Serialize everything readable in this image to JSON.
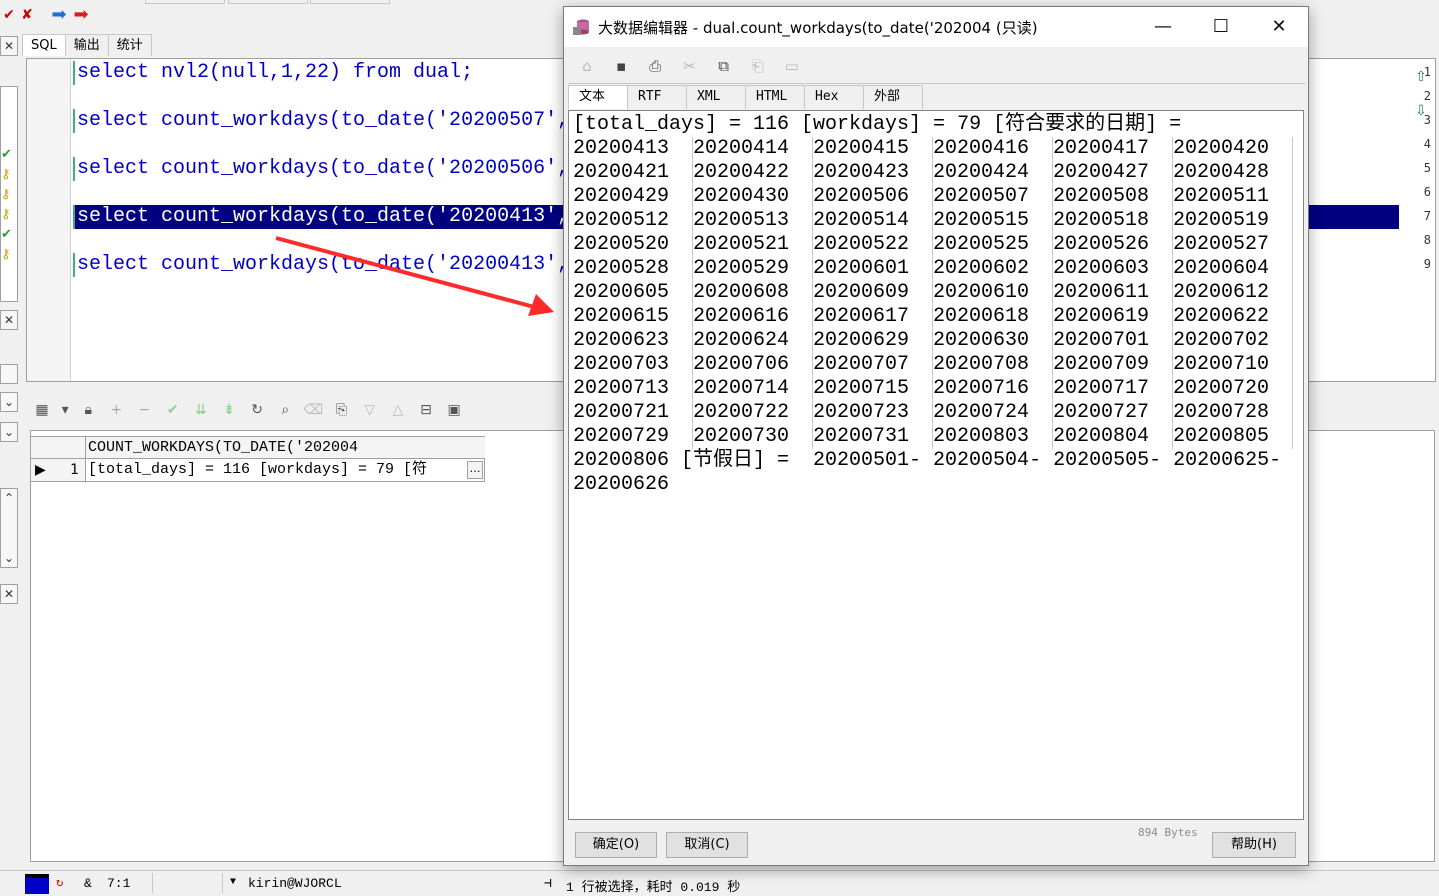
{
  "topbar": {
    "icons": [
      "run-icon",
      "stop-icon",
      "forward-icon",
      "back-icon"
    ]
  },
  "editor_tabs": [
    "SQL",
    "输出",
    "统计"
  ],
  "editor": {
    "lines": [
      {
        "num": "1",
        "text": "select nvl2(null,1,22) from dual;"
      },
      {
        "num": "2",
        "text": ""
      },
      {
        "num": "3",
        "text": "select count_workdays(to_date('20200507',"
      },
      {
        "num": "4",
        "text": ""
      },
      {
        "num": "5",
        "text": "select count_workdays(to_date('20200506',"
      },
      {
        "num": "6",
        "text": ""
      },
      {
        "num": "7",
        "text": "select count_workdays(to_date('20200413',"
      },
      {
        "num": "8",
        "text": ""
      },
      {
        "num": "9",
        "text": "select count_workdays(to_date('20200413',"
      }
    ],
    "selected_line": "7"
  },
  "grid": {
    "column_header": "COUNT_WORKDAYS(TO_DATE('202004",
    "row_number": "1",
    "cell_value": "[total_days] = 116 [workdays] = 79 [符",
    "cell_more": "…"
  },
  "status": {
    "mode": "&",
    "position": "7:1",
    "connection": "kirin@WJORCL",
    "message": "1 行被选择，耗时 0.019 秒"
  },
  "dialog": {
    "title": "大数据编辑器 - dual.count_workdays(to_date('202004 (只读)",
    "tabs": [
      "文本",
      "RTF",
      "XML",
      "HTML",
      "Hex",
      "外部"
    ],
    "first_line": "[total_days] = 116 [workdays] = 79 [符合要求的日期] =",
    "date_rows": [
      [
        "20200413",
        "20200414",
        "20200415",
        "20200416",
        "20200417",
        "20200420"
      ],
      [
        "20200421",
        "20200422",
        "20200423",
        "20200424",
        "20200427",
        "20200428"
      ],
      [
        "20200429",
        "20200430",
        "20200506",
        "20200507",
        "20200508",
        "20200511"
      ],
      [
        "20200512",
        "20200513",
        "20200514",
        "20200515",
        "20200518",
        "20200519"
      ],
      [
        "20200520",
        "20200521",
        "20200522",
        "20200525",
        "20200526",
        "20200527"
      ],
      [
        "20200528",
        "20200529",
        "20200601",
        "20200602",
        "20200603",
        "20200604"
      ],
      [
        "20200605",
        "20200608",
        "20200609",
        "20200610",
        "20200611",
        "20200612"
      ],
      [
        "20200615",
        "20200616",
        "20200617",
        "20200618",
        "20200619",
        "20200622"
      ],
      [
        "20200623",
        "20200624",
        "20200629",
        "20200630",
        "20200701",
        "20200702"
      ],
      [
        "20200703",
        "20200706",
        "20200707",
        "20200708",
        "20200709",
        "20200710"
      ],
      [
        "20200713",
        "20200714",
        "20200715",
        "20200716",
        "20200717",
        "20200720"
      ],
      [
        "20200721",
        "20200722",
        "20200723",
        "20200724",
        "20200727",
        "20200728"
      ],
      [
        "20200729",
        "20200730",
        "20200731",
        "20200803",
        "20200804",
        "20200805"
      ]
    ],
    "holiday_line": "20200806 [节假日] =  20200501- 20200504- 20200505- 20200625-",
    "last_line": "20200626",
    "bytes": "894 Bytes",
    "ok_label": "确定(O)",
    "cancel_label": "取消(C)",
    "help_label": "帮助(H)"
  },
  "colors": {
    "selection": "#000080",
    "keyword": "#0000c8",
    "string": "#0000ff",
    "arrow": "#ff2a2a"
  }
}
